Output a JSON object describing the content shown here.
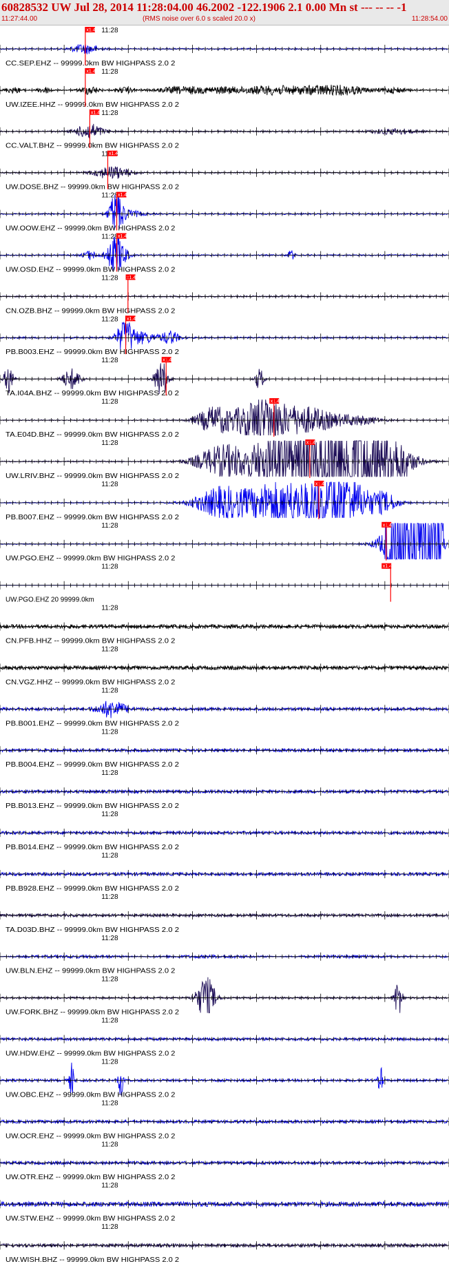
{
  "header": {
    "title": "60828532 UW Jul 28, 2014 11:28:04.00   46.2002 -122.1906  2.1 0.00 Mn st --- -- --   -1",
    "start_time": "11:27:44.00",
    "rms_note": "(RMS noise over 6.0 s scaled 20.0 x)",
    "end_time": "11:28:54.00"
  },
  "time_label": "11:28",
  "pick_label": "x1.4",
  "colors": {
    "header_text": "#cc0000",
    "header_bg": "#e9e9e9",
    "blue_trace": "#0000ee",
    "black_trace": "#000000",
    "dark_trace": "#1a0a55",
    "pick": "#ff0000"
  },
  "traces": [
    {
      "label": "CC.SEP.EHZ -- 99999.0km BW  HIGHPASS  2.0  2",
      "color": "blue",
      "pick": 0.19,
      "mark": 0.19,
      "amp": 0.12,
      "env": [
        [
          0.19,
          0.03,
          0.9
        ]
      ]
    },
    {
      "label": "UW.IZEE.HHZ -- 99999.0km BW  HIGHPASS  2.0  2",
      "color": "black",
      "pick": 0.19,
      "mark": 0.19,
      "amp": 0.1,
      "env": [
        [
          0.03,
          0.02,
          0.5
        ],
        [
          0.1,
          0.015,
          0.6
        ],
        [
          0.2,
          0.02,
          0.8
        ],
        [
          0.28,
          0.02,
          0.5
        ],
        [
          0.4,
          0.05,
          0.6
        ],
        [
          0.5,
          0.06,
          0.6
        ],
        [
          0.6,
          0.05,
          0.7
        ],
        [
          0.7,
          0.07,
          0.8
        ],
        [
          0.78,
          0.05,
          0.6
        ],
        [
          0.88,
          0.03,
          0.5
        ]
      ]
    },
    {
      "label": "CC.VALT.BHZ -- 99999.0km BW  HIGHPASS  2.0  2",
      "color": "dark",
      "pick": 0.2,
      "mark": 0.2,
      "amp": 0.12,
      "env": [
        [
          0.2,
          0.03,
          1.4
        ],
        [
          0.88,
          0.05,
          0.5
        ]
      ]
    },
    {
      "label": "UW.DOSE.BHZ -- 99999.0km BW  HIGHPASS  2.0  2",
      "color": "dark",
      "pick": 0.24,
      "mark": 0.24,
      "amp": 0.1,
      "env": [
        [
          0.25,
          0.04,
          1.2
        ]
      ]
    },
    {
      "label": "UW.OOW.EHZ -- 99999.0km BW  HIGHPASS  2.0  2",
      "color": "blue",
      "pick": 0.26,
      "mark": 0.26,
      "amp": 0.12,
      "env": [
        [
          0.26,
          0.015,
          4.2
        ],
        [
          0.29,
          0.03,
          0.6
        ]
      ]
    },
    {
      "label": "UW.OSD.EHZ -- 99999.0km BW  HIGHPASS  2.0  2",
      "color": "blue",
      "pick": 0.26,
      "mark": 0.26,
      "amp": 0.12,
      "env": [
        [
          0.2,
          0.015,
          0.8
        ],
        [
          0.26,
          0.02,
          4.0
        ],
        [
          0.65,
          0.008,
          0.9
        ]
      ]
    },
    {
      "label": "CN.OZB.BHZ -- 99999.0km BW  HIGHPASS  2.0  2",
      "color": "dark",
      "pick": 0.28,
      "mark": 0.285,
      "amp": 0.12,
      "env": []
    },
    {
      "label": "PB.B003.EHZ -- 99999.0km BW  HIGHPASS  2.0  2",
      "color": "blue",
      "pick": 0.28,
      "mark": 0.28,
      "amp": 0.14,
      "env": [
        [
          0.28,
          0.02,
          3.0
        ],
        [
          0.32,
          0.03,
          1.0
        ],
        [
          0.38,
          0.02,
          1.2
        ]
      ]
    },
    {
      "label": "TA.I04A.BHZ -- 99999.0km BW  HIGHPASS  2.0  2",
      "color": "dark",
      "pick": 0.36,
      "mark": 0.37,
      "amp": 0.04,
      "env": [
        [
          0.02,
          0.01,
          3.0
        ],
        [
          0.16,
          0.02,
          2.0
        ],
        [
          0.36,
          0.015,
          3.5
        ],
        [
          0.58,
          0.01,
          2.0
        ]
      ]
    },
    {
      "label": "TA.E04D.BHZ -- 99999.0km BW  HIGHPASS  2.0  2",
      "color": "dark",
      "pick": 0.6,
      "mark": 0.61,
      "amp": 0.08,
      "env": [
        [
          0.48,
          0.04,
          2.5
        ],
        [
          0.58,
          0.05,
          4.5
        ],
        [
          0.68,
          0.07,
          2.5
        ],
        [
          0.8,
          0.05,
          0.8
        ]
      ]
    },
    {
      "label": "UW.LRIV.BHZ -- 99999.0km BW  HIGHPASS  2.0  2",
      "color": "dark",
      "pick": 0.68,
      "mark": 0.69,
      "amp": 0.1,
      "env": [
        [
          0.5,
          0.06,
          3.0
        ],
        [
          0.62,
          0.06,
          5.0
        ],
        [
          0.78,
          0.09,
          12.0
        ],
        [
          0.88,
          0.04,
          2.0
        ]
      ]
    },
    {
      "label": "PB.B007.EHZ -- 99999.0km BW  HIGHPASS  2.0  2",
      "color": "blue",
      "pick": 0.7,
      "mark": 0.71,
      "amp": 0.1,
      "env": [
        [
          0.5,
          0.06,
          3.0
        ],
        [
          0.62,
          0.06,
          4.0
        ],
        [
          0.75,
          0.07,
          6.0
        ],
        [
          0.86,
          0.03,
          1.5
        ]
      ]
    },
    {
      "label": "UW.PGO.EHZ -- 99999.0km BW  HIGHPASS  2.0  2",
      "color": "blue",
      "pick": 0.85,
      "mark": 0.86,
      "amp": 0.08,
      "env": [
        [
          0.92,
          0.05,
          12.0
        ]
      ],
      "block": [
        0.86,
        0.99
      ]
    },
    {
      "label": "UW.PGO.EHZ 20 99999.0km",
      "color": "blue",
      "pick": 0.85,
      "mark": 0.87,
      "amp": 0.0,
      "env": []
    },
    {
      "label": "CN.PFB.HHZ -- 99999.0km BW  HIGHPASS  2.0  2",
      "color": "black",
      "pick": null,
      "mark": null,
      "amp": 0.35,
      "env": []
    },
    {
      "label": "CN.VGZ.HHZ -- 99999.0km BW  HIGHPASS  2.0  2",
      "color": "black",
      "pick": null,
      "mark": null,
      "amp": 0.35,
      "env": []
    },
    {
      "label": "PB.B001.EHZ -- 99999.0km BW  HIGHPASS  2.0  2",
      "color": "blue",
      "pick": null,
      "mark": null,
      "amp": 0.28,
      "env": [
        [
          0.25,
          0.03,
          1.5
        ]
      ]
    },
    {
      "label": "PB.B004.EHZ -- 99999.0km BW  HIGHPASS  2.0  2",
      "color": "blue",
      "pick": null,
      "mark": null,
      "amp": 0.28,
      "env": []
    },
    {
      "label": "PB.B013.EHZ -- 99999.0km BW  HIGHPASS  2.0  2",
      "color": "blue",
      "pick": null,
      "mark": null,
      "amp": 0.28,
      "env": []
    },
    {
      "label": "PB.B014.EHZ -- 99999.0km BW  HIGHPASS  2.0  2",
      "color": "blue",
      "pick": null,
      "mark": null,
      "amp": 0.28,
      "env": []
    },
    {
      "label": "PB.B928.EHZ -- 99999.0km BW  HIGHPASS  2.0  2",
      "color": "blue",
      "pick": null,
      "mark": null,
      "amp": 0.28,
      "env": []
    },
    {
      "label": "TA.D03D.BHZ -- 99999.0km BW  HIGHPASS  2.0  2",
      "color": "dark",
      "pick": null,
      "mark": null,
      "amp": 0.25,
      "env": []
    },
    {
      "label": "UW.BLN.EHZ -- 99999.0km BW  HIGHPASS  2.0  2",
      "color": "blue",
      "pick": null,
      "mark": null,
      "amp": 0.3,
      "wave": "beat"
    },
    {
      "label": "UW.FORK.BHZ -- 99999.0km BW  HIGHPASS  2.0  2",
      "color": "dark",
      "pick": null,
      "mark": null,
      "amp": 0.15,
      "env": [
        [
          0.46,
          0.02,
          4.0
        ],
        [
          0.89,
          0.008,
          4.0
        ]
      ]
    },
    {
      "label": "UW.HDW.EHZ -- 99999.0km BW  HIGHPASS  2.0  2",
      "color": "blue",
      "pick": null,
      "mark": null,
      "amp": 0.25,
      "env": []
    },
    {
      "label": "UW.OBC.EHZ -- 99999.0km BW  HIGHPASS  2.0  2",
      "color": "blue",
      "pick": null,
      "mark": null,
      "amp": 0.22,
      "env": [
        [
          0.16,
          0.005,
          3.0
        ],
        [
          0.27,
          0.005,
          3.0
        ],
        [
          0.85,
          0.005,
          2.5
        ]
      ]
    },
    {
      "label": "UW.OCR.EHZ -- 99999.0km BW  HIGHPASS  2.0  2",
      "color": "blue",
      "pick": null,
      "mark": null,
      "amp": 0.28,
      "env": []
    },
    {
      "label": "UW.OTR.EHZ -- 99999.0km BW  HIGHPASS  2.0  2",
      "color": "blue",
      "pick": null,
      "mark": null,
      "amp": 0.28,
      "env": []
    },
    {
      "label": "UW.STW.EHZ -- 99999.0km BW  HIGHPASS  2.0  2",
      "color": "blue",
      "pick": null,
      "mark": null,
      "amp": 0.42,
      "env": []
    },
    {
      "label": "UW.WISH.BHZ -- 99999.0km BW  HIGHPASS  2.0  2",
      "color": "dark",
      "pick": null,
      "mark": null,
      "amp": 0.3,
      "env": []
    }
  ]
}
